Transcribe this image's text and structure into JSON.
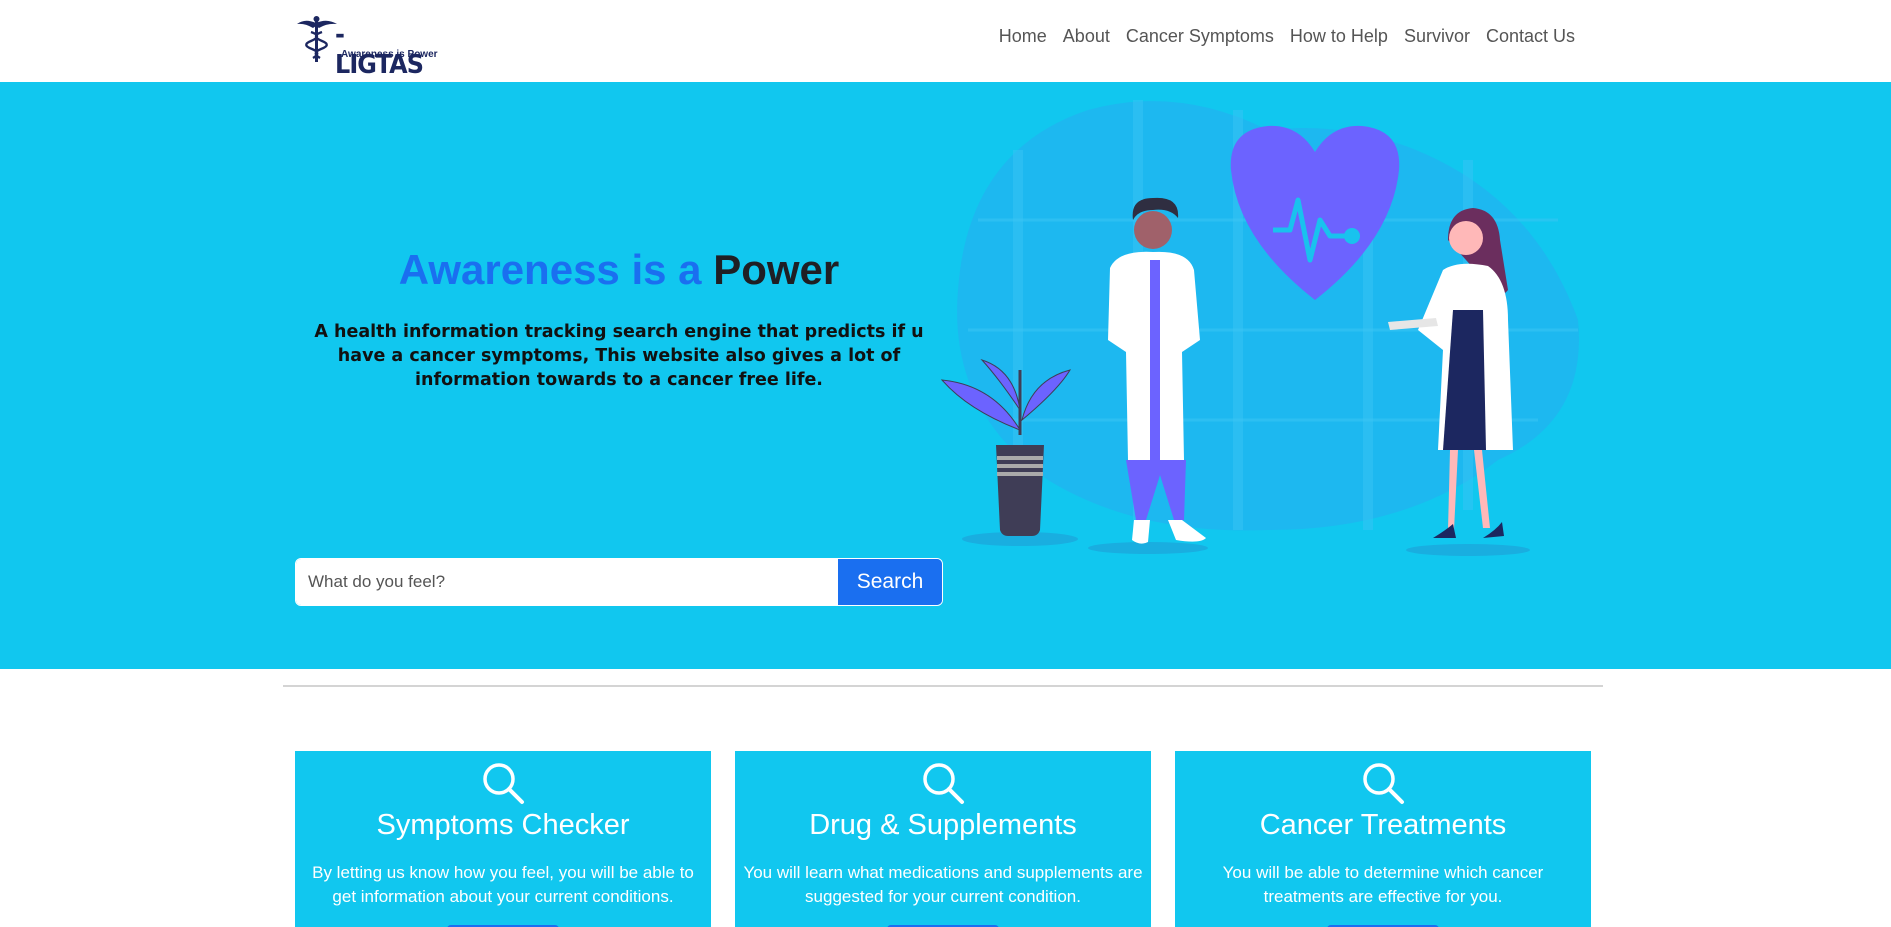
{
  "brand": {
    "name": "-LIGTAS",
    "tagline": "Awareness is Power"
  },
  "nav": {
    "items": [
      {
        "label": "Home"
      },
      {
        "label": "About"
      },
      {
        "label": "Cancer Symptoms"
      },
      {
        "label": "How to Help"
      },
      {
        "label": "Survivor"
      },
      {
        "label": "Contact Us"
      }
    ]
  },
  "hero": {
    "title_part1": "Awareness is a",
    "title_part2": "Power",
    "description": "A health information tracking search engine that predicts if u have a cancer symptoms, This website also gives a lot of information towards to a cancer free life.",
    "search_placeholder": "What do you feel?",
    "search_button": "Search"
  },
  "cards": [
    {
      "icon": "search-icon",
      "title": "Symptoms Checker",
      "text": "By letting us know how you feel, you will be able to get information about your current conditions."
    },
    {
      "icon": "search-icon",
      "title": "Drug & Supplements",
      "text": "You will learn what medications and supplements are suggested for your current condition."
    },
    {
      "icon": "search-icon",
      "title": "Cancer Treatments",
      "text": "You will be able to determine which cancer treatments are effective for you."
    }
  ],
  "colors": {
    "hero_bg": "#11c7ef",
    "accent_blue": "#1a6ff0",
    "brand_navy": "#1c2760",
    "illustration_purple": "#6c63ff"
  }
}
